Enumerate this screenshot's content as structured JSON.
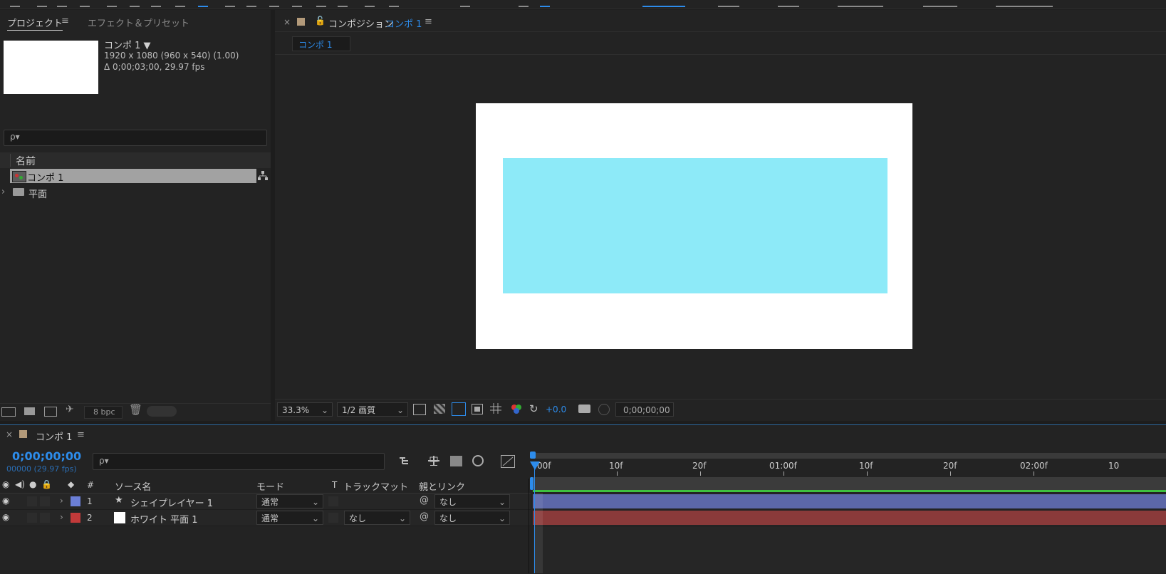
{
  "project_panel": {
    "tab_project": "プロジェクト",
    "tab_effects": "エフェクト＆プリセット",
    "comp_name": "コンポ 1 ▼",
    "comp_dims": "1920 x 1080  (960 x 540) (1.00)",
    "comp_duration": "Δ 0;00;03;00, 29.97 fps",
    "search_icon": "ρ▾",
    "col_name": "名前",
    "items": [
      {
        "label": "コンポ 1",
        "icon": "composition-icon"
      },
      {
        "label": "平面",
        "icon": "folder-icon"
      }
    ],
    "bpc": "8 bpc"
  },
  "viewer": {
    "close": "×",
    "title_prefix": "コンポジション",
    "title_comp": "コンポ 1",
    "menu": "≡",
    "sub_tab": "コンポ 1",
    "zoom": "33.3%",
    "resolution": "1/2 画質",
    "exposure": "+0.0",
    "timecode": "0;00;00;00"
  },
  "timeline": {
    "close": "×",
    "tab_title": "コンポ 1",
    "menu": "≡",
    "timecode": "0;00;00;00",
    "frames": "00000 (29.97 fps)",
    "ruler_labels": [
      "00f",
      "10f",
      "20f",
      "01:00f",
      "10f",
      "20f",
      "02:00f",
      "10"
    ],
    "col_hash": "#",
    "col_source": "ソース名",
    "col_mode": "モード",
    "col_t": "T",
    "col_trackmatte": "トラックマット",
    "col_parent": "親とリンク",
    "layers": [
      {
        "num": "1",
        "name": "シェイプレイヤー 1",
        "mode": "通常",
        "matte": "",
        "parent": "なし",
        "label_color": "#6b7fd7",
        "bar_color": "#5c67a8"
      },
      {
        "num": "2",
        "name": "ホワイト 平面 1",
        "mode": "通常",
        "matte": "なし",
        "parent": "なし",
        "label_color": "#c23a3a",
        "bar_color": "#8a3a3a"
      }
    ]
  },
  "colors": {
    "accent": "#2d8ceb",
    "shape_fill": "#8deaf8",
    "work_area": "#3ec13e"
  }
}
